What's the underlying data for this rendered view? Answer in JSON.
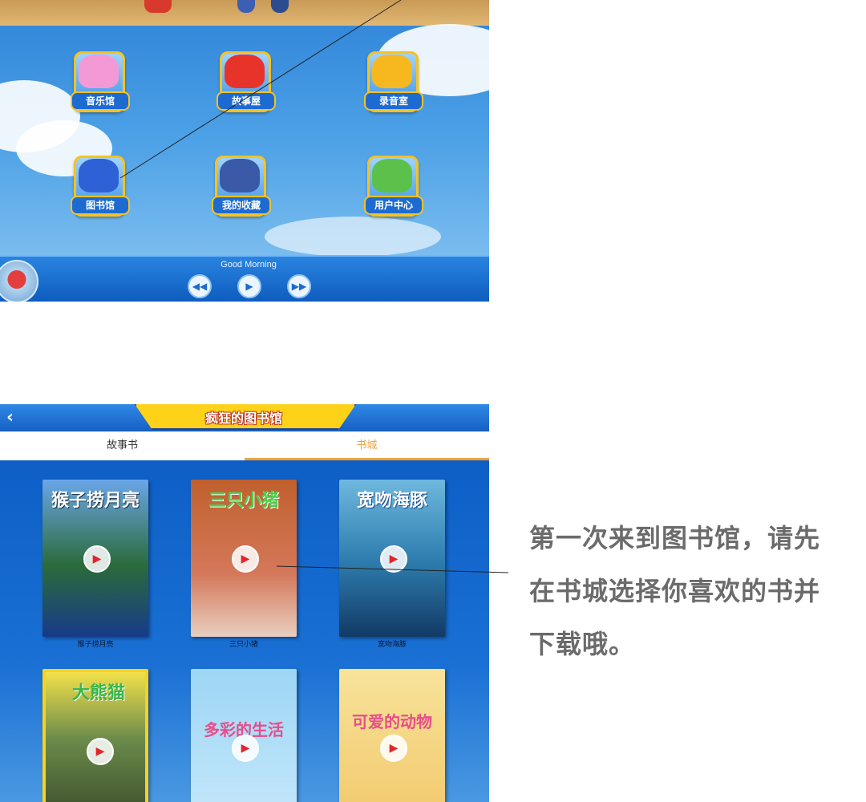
{
  "home": {
    "apps": [
      {
        "label": "音乐馆",
        "color": "#f39ad6"
      },
      {
        "label": "故事屋",
        "color": "#e8332b"
      },
      {
        "label": "录音室",
        "color": "#f7b81f"
      },
      {
        "label": "图书馆",
        "color": "#2f61d6"
      },
      {
        "label": "我的收藏",
        "color": "#3a5aa8"
      },
      {
        "label": "用户中心",
        "color": "#5cc14b"
      }
    ],
    "player": {
      "song": "Good Morning",
      "prev_icon": "skip-previous-icon",
      "play_icon": "play-icon",
      "next_icon": "skip-next-icon"
    }
  },
  "library": {
    "title": "疯狂的图书馆",
    "back_icon": "chevron-left-icon",
    "tabs": [
      {
        "label": "故事书",
        "active": false
      },
      {
        "label": "书城",
        "active": true
      }
    ],
    "books": [
      {
        "cover_title": "猴子捞月亮",
        "caption": "猴子捞月亮",
        "bg": "#2a6b3a",
        "fg": "#ffffff"
      },
      {
        "cover_title": "三只小猪",
        "caption": "三只小猪",
        "bg": "#c0602e",
        "fg": "#49d24c"
      },
      {
        "cover_title": "宽吻海豚",
        "caption": "宽吻海豚",
        "bg": "#6fb8de",
        "fg": "#ffffff"
      },
      {
        "cover_title": "大熊猫",
        "caption": "",
        "bg": "#f2e14a",
        "fg": "#3ab54a"
      },
      {
        "cover_title": "多彩的生活",
        "caption": "",
        "bg": "#9dd6f5",
        "fg": "#e84d8a"
      },
      {
        "cover_title": "可爱的动物",
        "caption": "",
        "bg": "#f7e39a",
        "fg": "#e84d8a"
      }
    ]
  },
  "annotation": {
    "text": "第一次来到图书馆，请先在书城选择你喜欢的书并下载哦。"
  }
}
